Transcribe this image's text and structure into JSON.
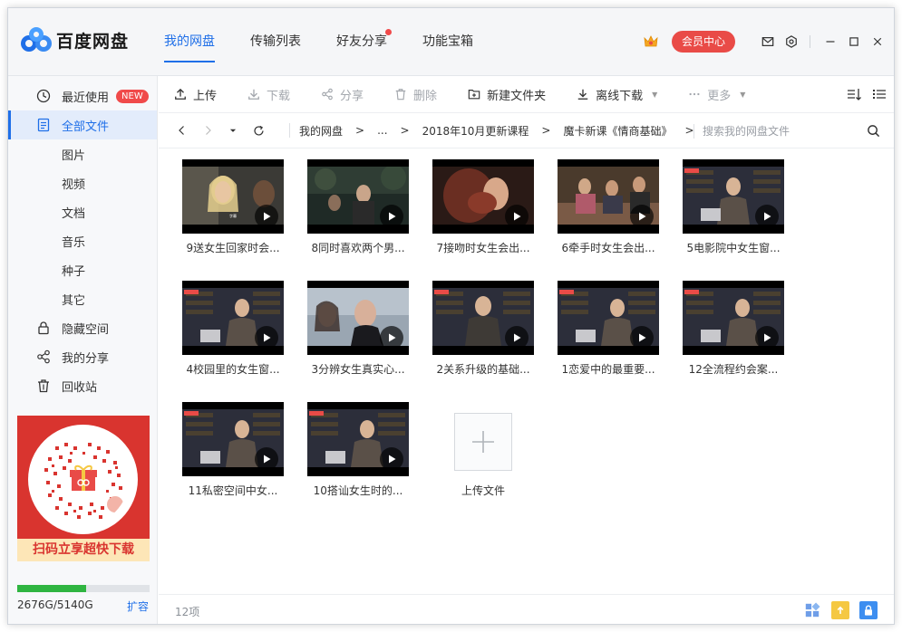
{
  "app": {
    "name": "百度网盘"
  },
  "topnav": [
    {
      "label": "我的网盘",
      "active": true
    },
    {
      "label": "传输列表"
    },
    {
      "label": "好友分享",
      "dot": true
    },
    {
      "label": "功能宝箱"
    }
  ],
  "header": {
    "vip_label": "会员中心"
  },
  "sidebar": {
    "items": [
      {
        "label": "最近使用",
        "icon": "clock-icon",
        "badge": "NEW"
      },
      {
        "label": "全部文件",
        "icon": "file-icon",
        "active": true
      },
      {
        "label": "图片"
      },
      {
        "label": "视频"
      },
      {
        "label": "文档"
      },
      {
        "label": "音乐"
      },
      {
        "label": "种子"
      },
      {
        "label": "其它"
      },
      {
        "label": "隐藏空间",
        "icon": "lock-icon"
      },
      {
        "label": "我的分享",
        "icon": "share-icon"
      },
      {
        "label": "回收站",
        "icon": "trash-icon"
      }
    ],
    "promo": {
      "text": "扫码立享超快下载"
    },
    "storage": {
      "text": "2676G/5140G",
      "used_fraction": 0.52,
      "expand_label": "扩容"
    }
  },
  "toolbar": {
    "upload": "上传",
    "download": "下载",
    "share": "分享",
    "delete": "删除",
    "new_folder": "新建文件夹",
    "offline_download": "离线下载",
    "more": "更多"
  },
  "path": {
    "crumbs": [
      "我的网盘",
      "...",
      "2018年10月更新课程",
      "魔卡新课《情商基础》"
    ],
    "separator": ">",
    "search_placeholder": "搜索我的网盘文件"
  },
  "files": [
    {
      "name": "9送女生回家时会...",
      "scene": "blonde"
    },
    {
      "name": "8同时喜欢两个男...",
      "scene": "forest"
    },
    {
      "name": "7接吻时女生会出...",
      "scene": "kiss"
    },
    {
      "name": "6牵手时女生会出...",
      "scene": "sofa"
    },
    {
      "name": "5电影院中女生窗...",
      "scene": "speaker"
    },
    {
      "name": "4校园里的女生窗...",
      "scene": "speaker"
    },
    {
      "name": "3分辨女生真实心...",
      "scene": "couple"
    },
    {
      "name": "2关系升级的基础...",
      "scene": "speaker2"
    },
    {
      "name": "1恋爱中的最重要...",
      "scene": "speaker"
    },
    {
      "name": "12全流程约会案...",
      "scene": "speaker"
    },
    {
      "name": "11私密空间中女...",
      "scene": "speaker"
    },
    {
      "name": "10搭讪女生时的...",
      "scene": "speaker"
    }
  ],
  "upload_tile": {
    "label": "上传文件"
  },
  "status": {
    "count": "12项"
  },
  "colors": {
    "accent": "#1f6fe8",
    "vip": "#e94b47",
    "storage": "#2fb541"
  }
}
